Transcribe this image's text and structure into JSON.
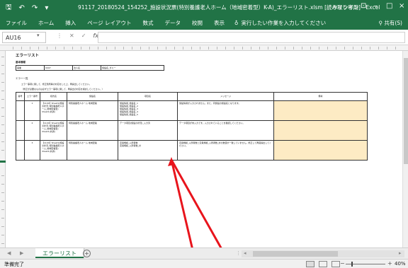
{
  "window": {
    "title": "91117_20180524_154252_施設状況票(特別養護老人ホーム（地域密着型）K-A)_エラーリスト.xlsm [読み取り専用] - Excel",
    "signin": "サインイン",
    "accent": "#217346"
  },
  "ribbon": {
    "tabs": [
      "ファイル",
      "ホーム",
      "挿入",
      "ページ レイアウト",
      "数式",
      "データ",
      "校閲",
      "表示"
    ],
    "tell_me": "実行したい作業を入力してください",
    "share": "共有(S)"
  },
  "formula_bar": {
    "name_box": "AU16",
    "fx": "fx",
    "value": ""
  },
  "sheet": {
    "title": "エラーリスト",
    "label1": "基本情報",
    "info": [
      "事業",
      "0007",
      "法人名",
      "施設名_ダミー"
    ],
    "label2": "エラー一覧",
    "note1": "エラー事項に関して、修正箇所等の対応をした上、再提出してください。",
    "note2": "（修正が必要なものは必ずエラー事項に関して、再提出の対応を検討してください。）",
    "columns": [
      "番号",
      "エラー番号",
      "様式名",
      "施設名",
      "項目名",
      "メッセージ",
      "備考"
    ],
    "rows": [
      {
        "no": "",
        "err": "1",
        "form": "【1100】Sheet1(施設の状況_特別養護老人ホーム_地域密着型) Sheet1(共通)",
        "facility": "特別養護老人ホーム 地域密着",
        "item": "施設情報_施設名_1\n施設情報_施設名_2\n施設情報_施設名_3\n施設情報_施設名_4\n施設情報_施設名_5",
        "msg": "施設情報が入力されません。また、同施設の施設名となります。",
        "note": ""
      },
      {
        "no": "",
        "err": "2",
        "form": "【1100】Sheet1(施設の状況_特別養護老人ホーム_地域密着型) Sheet1(共通)",
        "facility": "特別養護老人ホーム 地域密着",
        "item": "データ項目(施設の状況)_入力済",
        "msg": "データ項目が未入力です。入力されていることを確認してください。",
        "note": ""
      },
      {
        "no": "",
        "err": "3",
        "form": "【1100】Sheet1(施設の状況_特別養護老人ホーム_地域密着型) Sheet1(共通)",
        "facility": "特別養護老人ホーム 地域密着",
        "item": "定員規模_入所者数\n定員規模_入所者数_計",
        "msg": "定員規模_入所者数と定員規模_入所者数_計の数値が一致していません。修正して再度提出してください。",
        "note": ""
      }
    ]
  },
  "tabs": {
    "sheet_tab": "エラーリスト",
    "add": "+"
  },
  "status": {
    "ready": "準備完了",
    "zoom": "40%",
    "zoom_fraction": 0.4
  }
}
